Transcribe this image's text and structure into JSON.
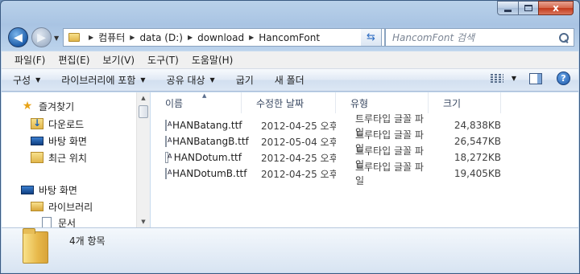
{
  "window": {
    "caption_glyphs": {
      "minimize": "▁",
      "maximize": "□",
      "close": "x"
    }
  },
  "navigation": {
    "address": {
      "crumbs": [
        "컴퓨터",
        "data (D:)",
        "download",
        "HancomFont"
      ]
    },
    "search": {
      "placeholder": "HancomFont 검색"
    }
  },
  "menu": {
    "items": [
      "파일(F)",
      "편집(E)",
      "보기(V)",
      "도구(T)",
      "도움말(H)"
    ]
  },
  "commands": {
    "items": [
      {
        "label": "구성",
        "has_dropdown": true
      },
      {
        "label": "라이브러리에 포함",
        "has_dropdown": true
      },
      {
        "label": "공유 대상",
        "has_dropdown": true
      },
      {
        "label": "굽기",
        "has_dropdown": false
      },
      {
        "label": "새 폴더",
        "has_dropdown": false
      }
    ],
    "help_glyph": "?"
  },
  "tree": {
    "favorites": "즐겨찾기",
    "downloads": "다운로드",
    "desktop_fav": "바탕 화면",
    "recent": "최근 위치",
    "desktop": "바탕 화면",
    "libraries": "라이브러리",
    "documents": "문서"
  },
  "columns": {
    "name": "이름",
    "modified": "수정한 날짜",
    "type": "유형",
    "size": "크기"
  },
  "files": [
    {
      "name": "HANBatang.ttf",
      "modified": "2012-04-25 오후...",
      "type": "트루타입 글꼴 파일",
      "size": "24,838KB"
    },
    {
      "name": "HANBatangB.ttf",
      "modified": "2012-05-04 오후...",
      "type": "트루타입 글꼴 파일",
      "size": "26,547KB"
    },
    {
      "name": "HANDotum.ttf",
      "modified": "2012-04-25 오후...",
      "type": "트루타입 글꼴 파일",
      "size": "18,272KB"
    },
    {
      "name": "HANDotumB.ttf",
      "modified": "2012-04-25 오후...",
      "type": "트루타입 글꼴 파일",
      "size": "19,405KB"
    }
  ],
  "status": {
    "item_count": "4개 항목"
  },
  "colors": {
    "accent": "#2d6cc2",
    "folder": "#e7b84a",
    "close_button": "#c2391b"
  }
}
